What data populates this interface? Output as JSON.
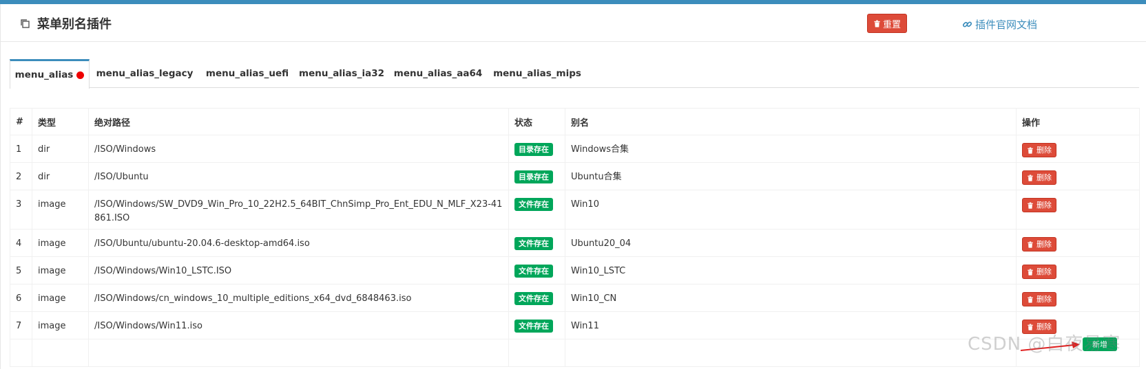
{
  "header": {
    "title": "菜单别名插件",
    "reset_label": "重置",
    "doc_link_label": "插件官网文档"
  },
  "tabs": [
    {
      "label": "menu_alias",
      "active": true,
      "has_dot": true
    },
    {
      "label": "menu_alias_legacy"
    },
    {
      "label": "menu_alias_uefi"
    },
    {
      "label": "menu_alias_ia32"
    },
    {
      "label": "menu_alias_aa64"
    },
    {
      "label": "menu_alias_mips"
    }
  ],
  "table": {
    "columns": [
      "#",
      "类型",
      "绝对路径",
      "状态",
      "别名",
      "操作"
    ],
    "rows": [
      {
        "num": "1",
        "type": "dir",
        "path": "/ISO/Windows",
        "status": "目录存在",
        "alias": "Windows合集",
        "action": "删除"
      },
      {
        "num": "2",
        "type": "dir",
        "path": "/ISO/Ubuntu",
        "status": "目录存在",
        "alias": "Ubuntu合集",
        "action": "删除"
      },
      {
        "num": "3",
        "type": "image",
        "path": "/ISO/Windows/SW_DVD9_Win_Pro_10_22H2.5_64BIT_ChnSimp_Pro_Ent_EDU_N_MLF_X23-41861.ISO",
        "status": "文件存在",
        "alias": "Win10",
        "action": "删除"
      },
      {
        "num": "4",
        "type": "image",
        "path": "/ISO/Ubuntu/ubuntu-20.04.6-desktop-amd64.iso",
        "status": "文件存在",
        "alias": "Ubuntu20_04",
        "action": "删除"
      },
      {
        "num": "5",
        "type": "image",
        "path": "/ISO/Windows/Win10_LSTC.ISO",
        "status": "文件存在",
        "alias": "Win10_LSTC",
        "action": "删除"
      },
      {
        "num": "6",
        "type": "image",
        "path": "/ISO/Windows/cn_windows_10_multiple_editions_x64_dvd_6848463.iso",
        "status": "文件存在",
        "alias": "Win10_CN",
        "action": "删除"
      },
      {
        "num": "7",
        "type": "image",
        "path": "/ISO/Windows/Win11.iso",
        "status": "文件存在",
        "alias": "Win11",
        "action": "删除"
      }
    ],
    "add_label": "新增"
  },
  "watermark": "CSDN @白夜易寒",
  "colors": {
    "primary": "#3c8dbc",
    "danger": "#dd4b39",
    "success": "#00a65a"
  },
  "icons": {
    "title": "copy-icon",
    "reset": "trash-icon",
    "doc": "link-icon",
    "delete": "trash-icon"
  }
}
